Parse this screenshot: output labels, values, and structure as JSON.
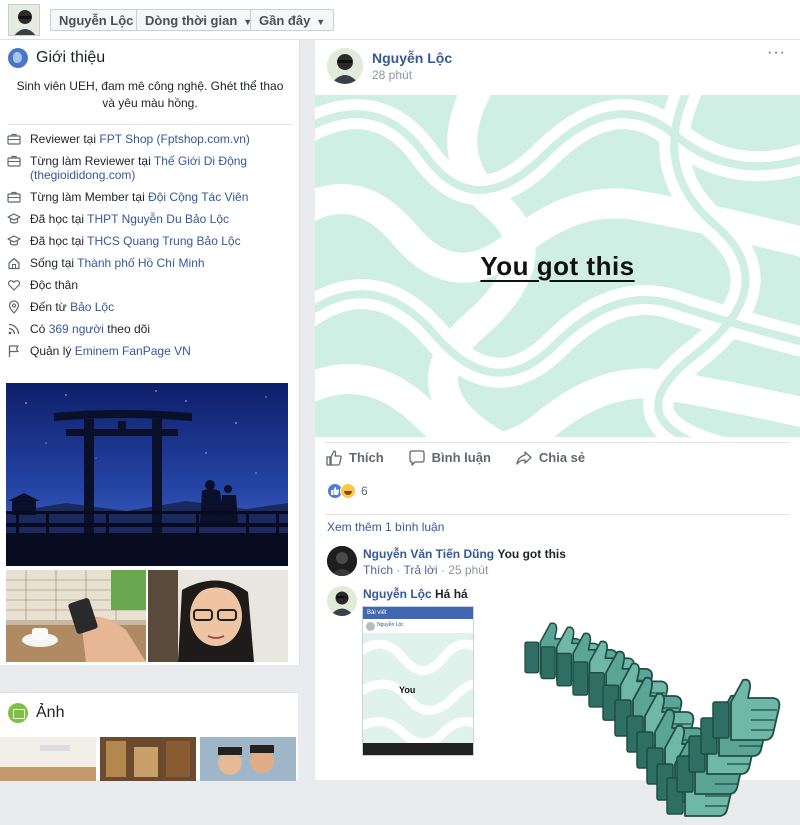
{
  "topbar": {
    "profile_name": "Nguyễn Lộc",
    "timeline_label": "Dòng thời gian",
    "recent_label": "Gần đây"
  },
  "intro": {
    "title": "Giới thiệu",
    "bio": "Sinh viên UEH, đam mê công nghệ. Ghét thể thao và yêu màu hồng.",
    "items": [
      {
        "icon": "briefcase-icon",
        "prefix": "Reviewer tại ",
        "link": "FPT Shop (Fptshop.com.vn)",
        "suffix": ""
      },
      {
        "icon": "briefcase-icon",
        "prefix": "Từng làm Reviewer tại ",
        "link": "Thế Giới Di Động (thegioididong.com)",
        "suffix": ""
      },
      {
        "icon": "briefcase-icon",
        "prefix": "Từng làm Member tại ",
        "link": "Đội Cộng Tác Viên",
        "suffix": ""
      },
      {
        "icon": "graduation-cap-icon",
        "prefix": "Đã học tại ",
        "link": "THPT Nguyễn Du Bảo Lộc",
        "suffix": ""
      },
      {
        "icon": "graduation-cap-icon",
        "prefix": "Đã học tại ",
        "link": "THCS Quang Trung Bảo Lộc",
        "suffix": ""
      },
      {
        "icon": "home-icon",
        "prefix": "Sống tại ",
        "link": "Thành phố Hồ Chí Minh",
        "suffix": ""
      },
      {
        "icon": "heart-icon",
        "prefix": "Độc thân",
        "link": "",
        "suffix": ""
      },
      {
        "icon": "location-pin-icon",
        "prefix": "Đến từ ",
        "link": "Bảo Lộc",
        "suffix": ""
      },
      {
        "icon": "rss-icon",
        "prefix": "Có ",
        "link": "369 người",
        "suffix": " theo dõi"
      },
      {
        "icon": "flag-icon",
        "prefix": "Quản lý ",
        "link": "Eminem FanPage VN",
        "suffix": ""
      }
    ]
  },
  "photos": {
    "title": "Ảnh"
  },
  "post": {
    "author": "Nguyễn Lộc",
    "time": "28 phút",
    "more": "···",
    "caption": "You got this",
    "actions": {
      "like": "Thích",
      "comment": "Bình luận",
      "share": "Chia sẻ"
    },
    "reaction_count": "6",
    "view_more": "Xem thêm 1 bình luận",
    "comments": [
      {
        "author": "Nguyễn Văn Tiến Dũng",
        "text": "You got this",
        "like": "Thích",
        "reply": "Trả lời",
        "time": "25 phút"
      },
      {
        "author": "Nguyễn Lộc",
        "text": "Há há"
      }
    ],
    "screenshot": {
      "bar_title": "Bài viết",
      "author": "Nguyễn Lộc",
      "caption": "You"
    }
  },
  "colors": {
    "link": "#365899",
    "pattern": "#cfeee4",
    "thumb": "#5aa596"
  }
}
